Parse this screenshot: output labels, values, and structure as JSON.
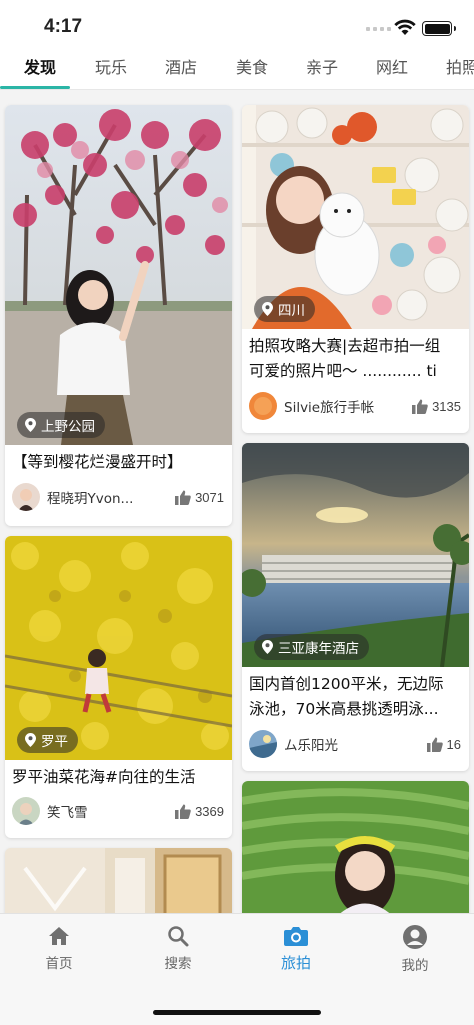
{
  "status_bar": {
    "time": "4:17"
  },
  "tabs": [
    {
      "label": "发现",
      "active": true
    },
    {
      "label": "玩乐"
    },
    {
      "label": "酒店"
    },
    {
      "label": "美食"
    },
    {
      "label": "亲子"
    },
    {
      "label": "网红"
    },
    {
      "label": "拍照"
    }
  ],
  "feed": {
    "left": [
      {
        "location": "上野公园",
        "title": "【等到樱花烂漫盛开时】",
        "author": "程晓玥Yvon...",
        "likes": "3071"
      },
      {
        "location": "罗平",
        "title": "罗平油菜花海#向往的生活",
        "author": "笑飞雪",
        "likes": "3369"
      },
      {
        "location": "",
        "title": "",
        "author": "",
        "likes": ""
      }
    ],
    "right": [
      {
        "location": "四川",
        "title_line1": "拍照攻略大赛|去超市拍一组",
        "title_line2": "可爱的照片吧～ ............ ti",
        "author": "Silvie旅行手帐",
        "likes": "3135"
      },
      {
        "location": "三亚康年酒店",
        "title_line1": "国内首创1200平米，无边际",
        "title_line2": "泳池，70米高悬挑透明泳...",
        "author": "ム乐阳光",
        "likes": "16"
      },
      {
        "location": "",
        "title": "",
        "author": "",
        "likes": ""
      }
    ]
  },
  "bottom_nav": [
    {
      "label": "首页",
      "icon": "home-icon"
    },
    {
      "label": "搜索",
      "icon": "search-icon"
    },
    {
      "label": "旅拍",
      "icon": "camera-icon",
      "active": true
    },
    {
      "label": "我的",
      "icon": "profile-icon"
    }
  ],
  "colors": {
    "accent": "#2bb5a6",
    "active_nav": "#2b8fd6"
  }
}
